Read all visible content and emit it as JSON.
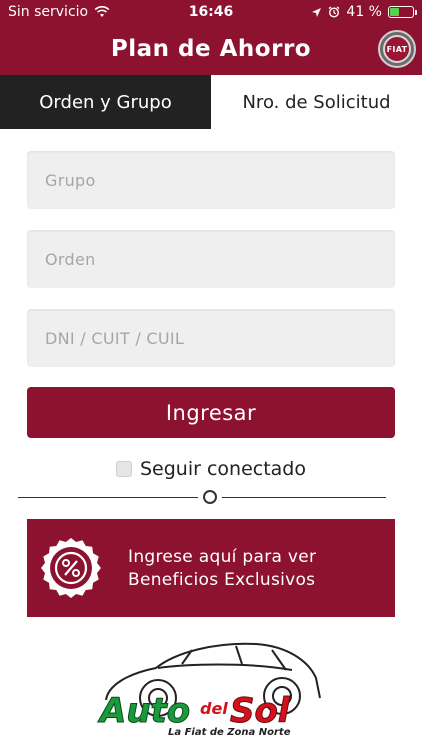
{
  "status_bar": {
    "carrier": "Sin servicio",
    "time": "16:46",
    "battery": "41 %",
    "battery_level": 0.41
  },
  "header": {
    "title": "Plan de Ahorro",
    "brand_logo_text": "FIAT"
  },
  "tabs": [
    {
      "label": "Orden y Grupo",
      "active": true
    },
    {
      "label": "Nro. de Solicitud",
      "active": false
    }
  ],
  "form": {
    "grupo_placeholder": "Grupo",
    "orden_placeholder": "Orden",
    "documento_placeholder": "DNI / CUIT / CUIL",
    "submit_label": "Ingresar",
    "remember_label": "Seguir conectado"
  },
  "benefits_banner": {
    "line1": "Ingrese aquí para ver",
    "line2": "Beneficios Exclusivos",
    "icon": "percent-badge-icon"
  },
  "dealer_logo": {
    "name_part1": "Auto",
    "name_part2": "del",
    "name_part3": "Sol",
    "tagline": "La Fiat de Zona Norte"
  },
  "colors": {
    "brand": "#8c1230",
    "tab_active": "#222222",
    "field_bg": "#efefef",
    "dealer_green": "#1a9a3a",
    "dealer_red": "#d4121b"
  }
}
